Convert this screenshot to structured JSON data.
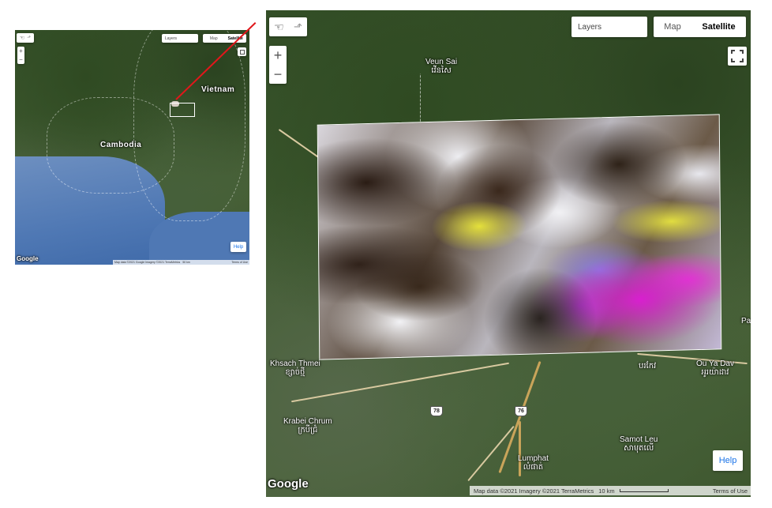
{
  "overview": {
    "layers_label": "Layers",
    "map_tab": "Map",
    "satellite_tab": "Satellite",
    "zoom_in": "+",
    "zoom_out": "−",
    "country_labels": [
      "Vietnam",
      "Cambodia"
    ],
    "help_label": "Help",
    "google_logo": "Google",
    "attribution": "Map data ©2021 Google Imagery ©2021 TerraMetrics",
    "scale": "50 km",
    "terms": "Terms of Use"
  },
  "main": {
    "layers_label": "Layers",
    "map_tab": "Map",
    "satellite_tab": "Satellite",
    "zoom_in": "+",
    "zoom_out": "−",
    "places": {
      "veun_sai": "Veun Sai",
      "veun_sai_km": "វើនសៃ",
      "khsach_thmei": "Khsach Thmei",
      "khsach_thmei_km": "ខ្សាច់ថ្មី",
      "krabei_chrum": "Krabei Chrum",
      "krabei_chrum_km": "ក្របីជ្រំ",
      "samot_leu": "Samot Leu",
      "samot_leu_km": "សាមុតលើ",
      "lumphat": "Lumphat",
      "lumphat_km": "លំផាត់",
      "ou_ya_dav": "Ou Ya Dav",
      "ou_ya_dav_km": "អូរយ៉ាដាវ",
      "partial_km": "បរកែវ",
      "partial_letter": "Pa"
    },
    "route_78": "78",
    "route_76": "76",
    "help_label": "Help",
    "google_logo": "Google",
    "attribution": "Map data ©2021 Imagery ©2021 TerraMetrics",
    "scale": "10 km",
    "terms": "Terms of Use"
  },
  "colors": {
    "connector": "#e0171b",
    "help_text": "#1a73e8"
  },
  "icons": [
    "pan-hand-icon",
    "draw-shape-icon",
    "fullscreen-icon"
  ]
}
